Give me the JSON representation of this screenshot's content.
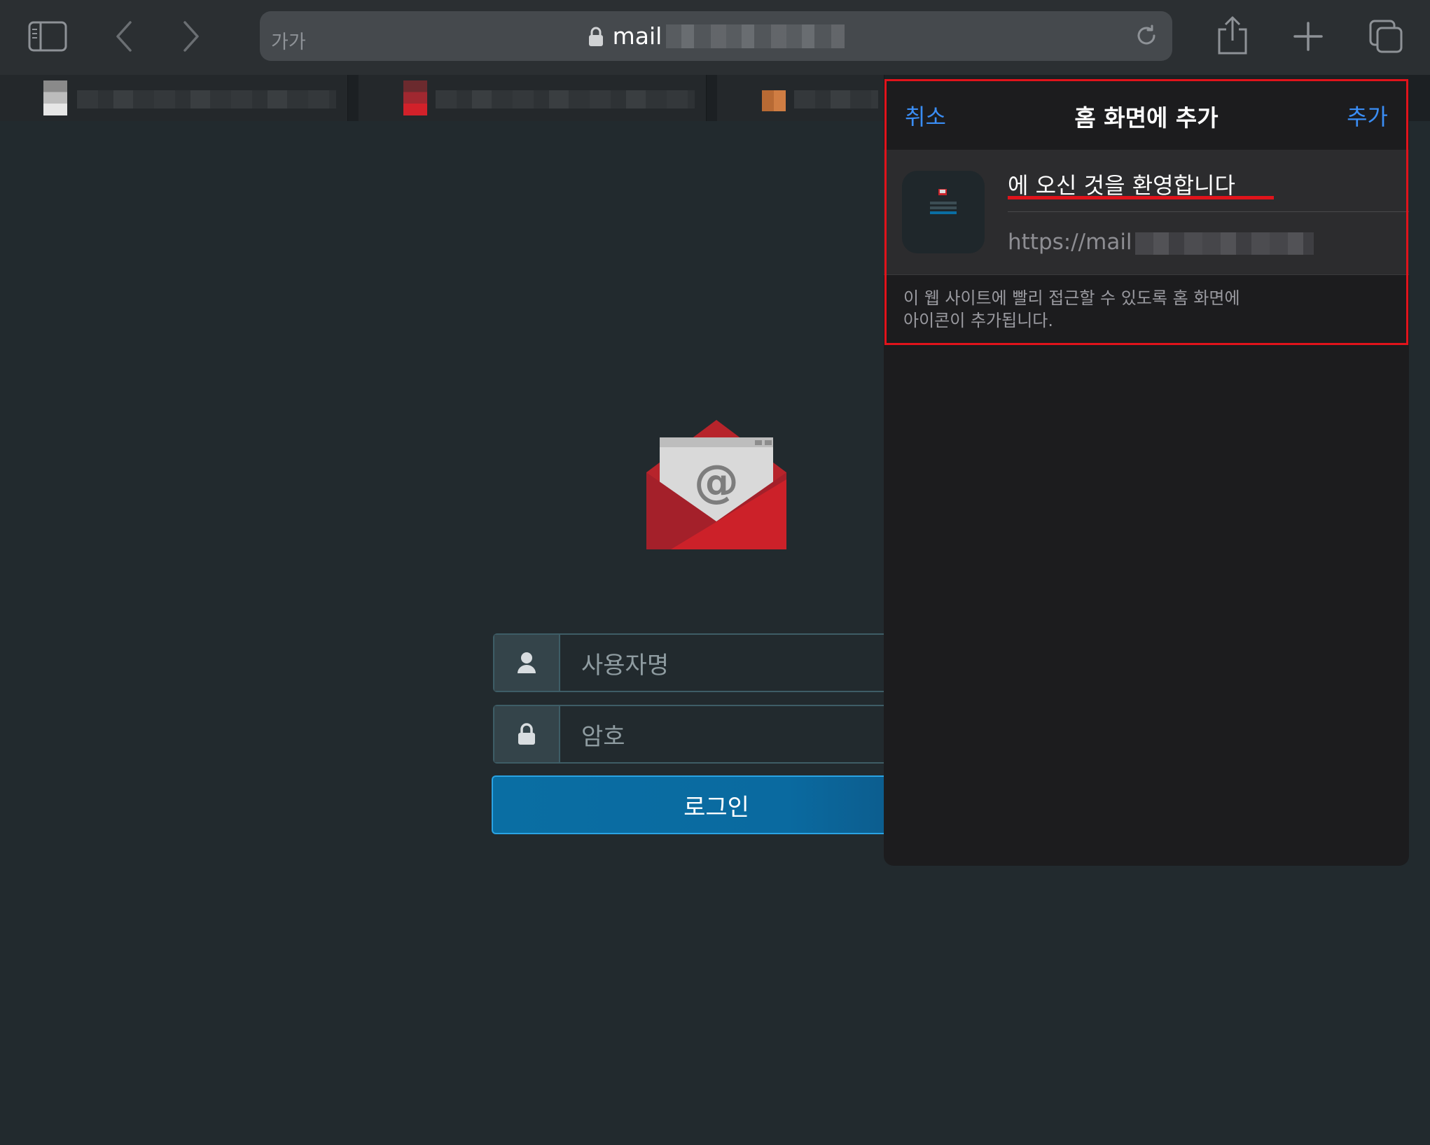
{
  "toolbar": {
    "text_size_label": "가가",
    "url_prefix": "mail",
    "icons": [
      "sidebar-icon",
      "back-icon",
      "forward-icon",
      "lock-icon",
      "reload-icon",
      "share-icon",
      "plus-icon",
      "tabs-icon"
    ]
  },
  "login": {
    "username_placeholder": "사용자명",
    "password_placeholder": "암호",
    "login_label": "로그인"
  },
  "add_to_home": {
    "cancel_label": "취소",
    "title": "홈 화면에 추가",
    "add_label": "추가",
    "name_value": "에 오신 것을 환영합니다",
    "url_value": "https://mail",
    "description": "이 웹 사이트에 빨리 접근할 수 있도록 홈 화면에\n아이콘이 추가됩니다."
  },
  "colors": {
    "accent_blue": "#3a8df5",
    "highlight_red": "#e0131b",
    "login_button": "#0a6ea3",
    "page_background": "#222a2e"
  }
}
